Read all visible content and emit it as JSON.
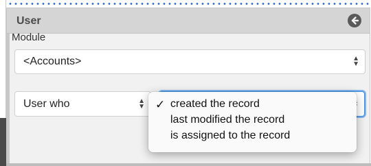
{
  "panel": {
    "title": "User",
    "module_label": "Module",
    "module_value": "<Accounts>",
    "user_who_value": "User who"
  },
  "dropdown": {
    "options": [
      {
        "label": "created the record",
        "selected": true
      },
      {
        "label": "last modified the record",
        "selected": false
      },
      {
        "label": "is assigned to the record",
        "selected": false
      }
    ],
    "check_glyph": "✓"
  }
}
